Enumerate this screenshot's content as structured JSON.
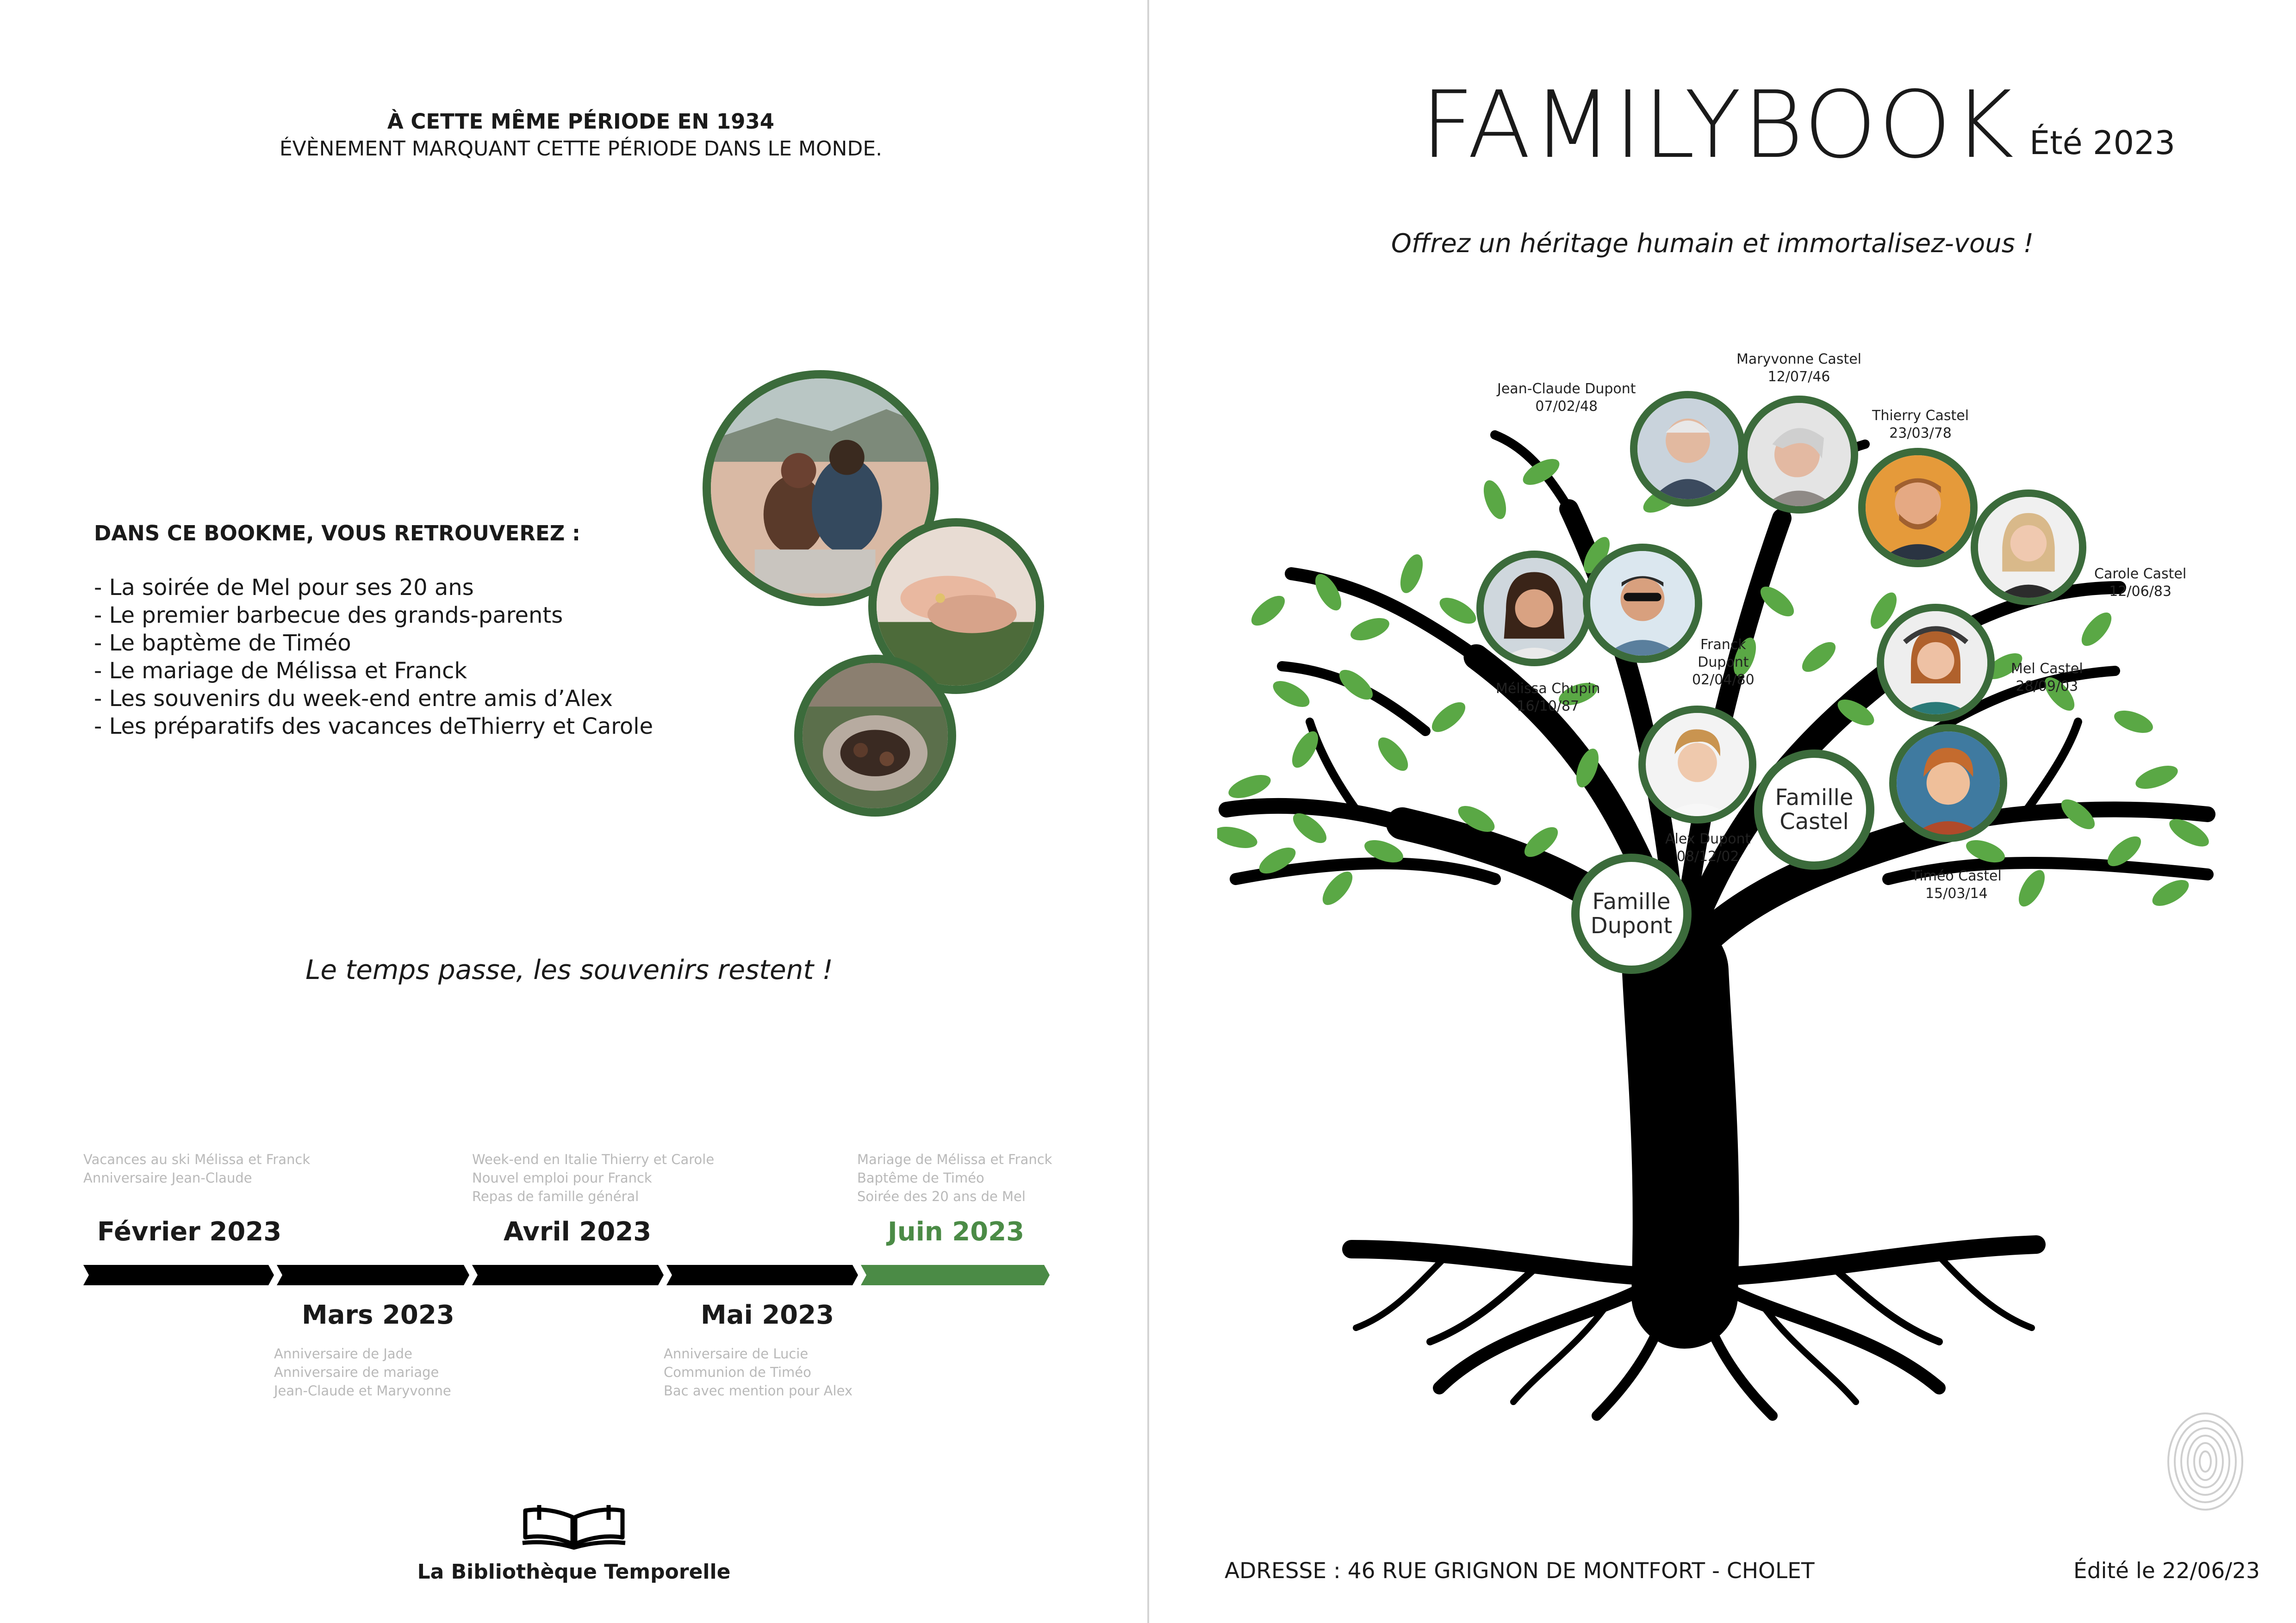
{
  "left_page": {
    "period_title": "À CETTE MÊME PÉRIODE EN 1934",
    "period_subtitle": "ÉVÈNEMENT MARQUANT CETTE PÉRIODE DANS LE MONDE.",
    "bookme_title": "DANS CE BOOKME, VOUS RETROUVEREZ :",
    "bookme_items": [
      "La soirée de Mel pour ses 20 ans",
      "Le premier barbecue des grands-parents",
      "Le baptème de Timéo",
      "Le mariage de Mélissa et Franck",
      "Les souvenirs du week-end entre amis d’Alex",
      "Les préparatifs des vacances deThierry et Carole"
    ],
    "slogan": "Le temps passe, les souvenirs restent !",
    "timeline": {
      "arrow_color": "#000000",
      "highlight_color": "#4b8b46",
      "months": [
        {
          "label": "Février 2023",
          "events": [
            "Vacances au ski Mélissa et Franck",
            "Anniversaire Jean-Claude"
          ]
        },
        {
          "label": "Mars 2023",
          "events": [
            "Anniversaire de Jade",
            "Anniversaire de mariage",
            "Jean-Claude et Maryvonne"
          ]
        },
        {
          "label": "Avril 2023",
          "events": [
            "Week-end en Italie Thierry et Carole",
            "Nouvel emploi pour Franck",
            "Repas de famille général"
          ]
        },
        {
          "label": "Mai 2023",
          "events": [
            "Anniversaire de Lucie",
            "Communion de Timéo",
            "Bac avec mention pour Alex"
          ]
        },
        {
          "label": "Juin 2023",
          "events": [
            "Mariage de Mélissa et Franck",
            "Baptême de Timéo",
            "Soirée des 20 ans de Mel"
          ]
        }
      ]
    },
    "library_name": "La Bibliothèque Temporelle",
    "library_icon": "open-book-icon"
  },
  "right_page": {
    "title": "FAMILYBOOK",
    "season": "Été 2023",
    "slogan": "Offrez un héritage humain et immortalisez-vous !",
    "accent_color": "#3b6b3b",
    "leaf_color": "#5aa845",
    "families": [
      "Famille Dupont",
      "Famille Castel"
    ],
    "people": [
      {
        "name": "Jean-Claude Dupont",
        "date": "07/02/48"
      },
      {
        "name": "Maryvonne Castel",
        "date": "12/07/46"
      },
      {
        "name": "Thierry Castel",
        "date": "23/03/78"
      },
      {
        "name": "Carole Castel",
        "date": "12/06/83"
      },
      {
        "name": "Franck",
        "name2": "Dupont",
        "date": "02/04/80"
      },
      {
        "name": "Mélissa Chupin",
        "date": "16/10/87"
      },
      {
        "name": "Mel Castel",
        "date": "28/09/03"
      },
      {
        "name": "Alex Dupont",
        "date": "08/12/02"
      },
      {
        "name": "Timéo Castel",
        "date": "15/03/14"
      }
    ],
    "address": "ADRESSE : 46 RUE GRIGNON DE MONTFORT - CHOLET",
    "edited": "Édité le 22/06/23",
    "fingerprint_icon": "fingerprint-icon"
  }
}
